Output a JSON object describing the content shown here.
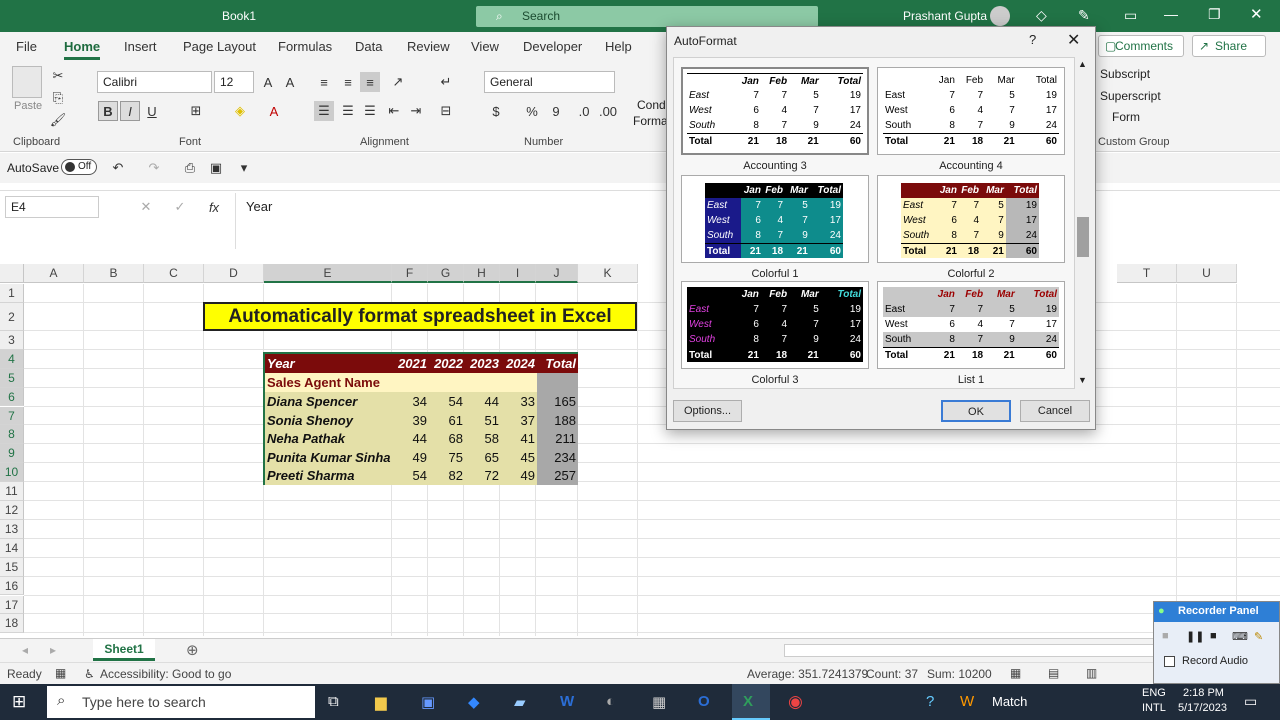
{
  "window": {
    "title": "Book1",
    "search": "Search",
    "user": "Prashant Gupta"
  },
  "tabs": [
    "File",
    "Home",
    "Insert",
    "Page Layout",
    "Formulas",
    "Data",
    "Review",
    "View",
    "Developer",
    "Help"
  ],
  "ribbon_actions": {
    "comments": "Comments",
    "share": "Share"
  },
  "ribbon": {
    "paste": "Paste",
    "font_name": "Calibri",
    "font_size": "12",
    "number_format": "General",
    "cond": "Condi",
    "forma": "Forma",
    "subscript": "Subscript",
    "superscript": "Superscript",
    "form": "Form",
    "custom_group": "Custom Group"
  },
  "group_labels": {
    "clipboard": "Clipboard",
    "font": "Font",
    "alignment": "Alignment",
    "number": "Number"
  },
  "qat": {
    "autosave": "AutoSave",
    "toggle": "Off"
  },
  "formula_bar": {
    "name_box": "E4",
    "fx": "fx",
    "value": "Year"
  },
  "columns": [
    "A",
    "B",
    "C",
    "D",
    "E",
    "F",
    "G",
    "H",
    "I",
    "J",
    "K",
    "T",
    "U"
  ],
  "rows": [
    "1",
    "2",
    "3",
    "4",
    "5",
    "6",
    "7",
    "8",
    "9",
    "10",
    "11",
    "12",
    "13",
    "14",
    "15",
    "16",
    "17",
    "18"
  ],
  "sheet": {
    "title_cell": "Automatically format spreadsheet in Excel",
    "header": [
      "Year",
      "2021",
      "2022",
      "2023",
      "2024",
      "Total"
    ],
    "subheader": "Sales Agent Name",
    "data": [
      [
        "Diana Spencer",
        "34",
        "54",
        "44",
        "33",
        "165"
      ],
      [
        "Sonia Shenoy",
        "39",
        "61",
        "51",
        "37",
        "188"
      ],
      [
        "Neha Pathak",
        "44",
        "68",
        "58",
        "41",
        "211"
      ],
      [
        "Punita Kumar Sinha",
        "49",
        "75",
        "65",
        "45",
        "234"
      ],
      [
        "Preeti Sharma",
        "54",
        "82",
        "72",
        "49",
        "257"
      ]
    ]
  },
  "sheet_tab": "Sheet1",
  "status": {
    "ready": "Ready",
    "accessibility": "Accessibility: Good to go",
    "average": "Average: 351.7241379",
    "count": "Count: 37",
    "sum": "Sum: 10200"
  },
  "dialog": {
    "title": "AutoFormat",
    "help": "?",
    "captions": [
      "Accounting 3",
      "Accounting 4",
      "Colorful 1",
      "Colorful 2",
      "Colorful 3",
      "List 1"
    ],
    "sample_header": [
      "",
      "Jan",
      "Feb",
      "Mar",
      "Total"
    ],
    "sample_rows": [
      [
        "East",
        "7",
        "7",
        "5",
        "19"
      ],
      [
        "West",
        "6",
        "4",
        "7",
        "17"
      ],
      [
        "South",
        "8",
        "7",
        "9",
        "24"
      ],
      [
        "Total",
        "21",
        "18",
        "21",
        "60"
      ]
    ],
    "currency": "$",
    "options": "Options...",
    "ok": "OK",
    "cancel": "Cancel"
  },
  "recorder": {
    "title": "Recorder Panel",
    "record_audio": "Record Audio"
  },
  "taskbar": {
    "search": "Type here to search",
    "match": "Match",
    "lang1": "ENG",
    "lang2": "INTL",
    "time": "2:18 PM",
    "date": "5/17/2023"
  }
}
